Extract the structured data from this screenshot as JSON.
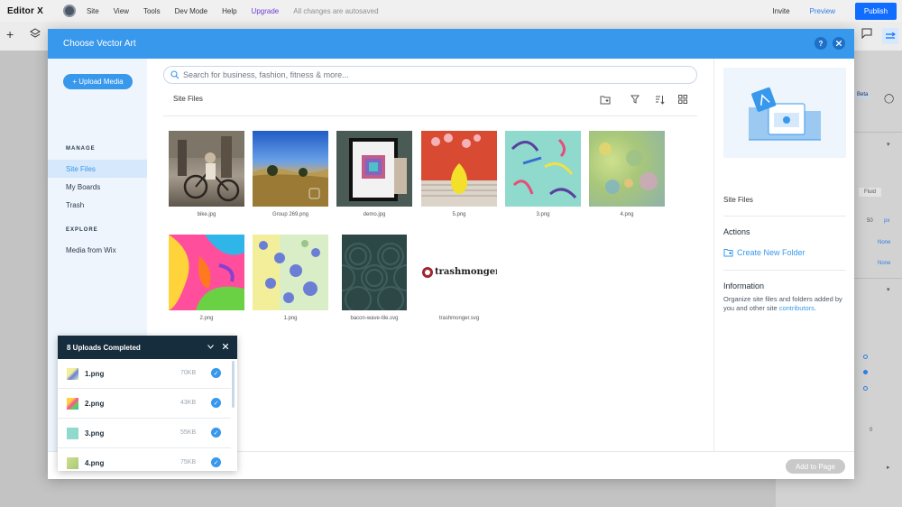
{
  "editor": {
    "logo": "Editor X",
    "menu": [
      "Site",
      "View",
      "Tools",
      "Dev Mode",
      "Help",
      "Upgrade"
    ],
    "autosave": "All changes are autosaved",
    "invite": "Invite",
    "preview": "Preview",
    "publish": "Publish"
  },
  "right_panel": {
    "beta": "Beta",
    "fluid": "Fluid",
    "value_50": "50",
    "px": "px",
    "none_1": "None",
    "none_2": "None",
    "value_0": "0"
  },
  "modal": {
    "title": "Choose Vector Art",
    "help": "?",
    "upload_button": "+ Upload Media",
    "manage_section": "MANAGE",
    "manage_items": [
      "Site Files",
      "My Boards",
      "Trash"
    ],
    "explore_section": "EXPLORE",
    "explore_items": [
      "Media from Wix"
    ],
    "search_placeholder": "Search for business, fashion, fitness & more...",
    "breadcrumb": "Site Files",
    "files": [
      {
        "name": "bike.jpg"
      },
      {
        "name": "Group 269.png"
      },
      {
        "name": "demo.jpg"
      },
      {
        "name": "5.png"
      },
      {
        "name": "3.png"
      },
      {
        "name": "4.png"
      },
      {
        "name": "2.png"
      },
      {
        "name": "1.png"
      },
      {
        "name": "bacon-wave-tile.svg"
      },
      {
        "name": "trashmonger.svg",
        "logo_text": "trashmonger"
      }
    ],
    "details": {
      "folder_name": "Site Files",
      "actions_title": "Actions",
      "create_folder": "Create New Folder",
      "info_title": "Information",
      "info_text": "Organize site files and folders added by you and other site",
      "info_link": "contributors",
      "info_end": "."
    },
    "add_to_page": "Add to Page"
  },
  "uploads": {
    "title": "8 Uploads Completed",
    "items": [
      {
        "name": "1.png",
        "size": "70KB"
      },
      {
        "name": "2.png",
        "size": "43KB"
      },
      {
        "name": "3.png",
        "size": "55KB"
      },
      {
        "name": "4.png",
        "size": "75KB"
      }
    ]
  },
  "colors": {
    "accent": "#3898ec",
    "header_dark": "#162d3d",
    "publish": "#116dff"
  }
}
